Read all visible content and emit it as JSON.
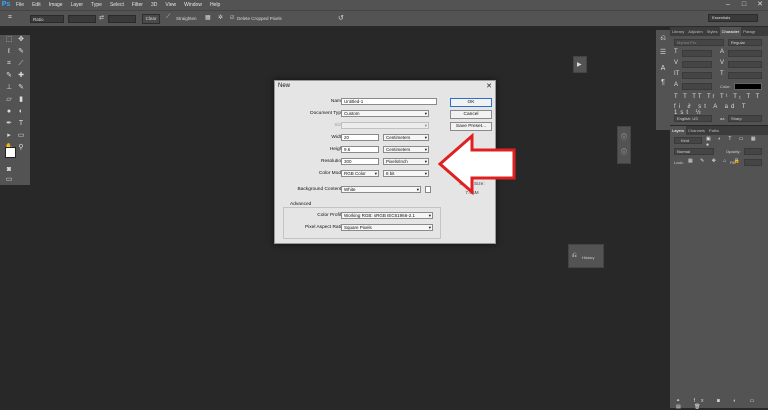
{
  "menubar": {
    "logo": "Ps",
    "items": [
      "File",
      "Edit",
      "Image",
      "Layer",
      "Type",
      "Select",
      "Filter",
      "3D",
      "View",
      "Window",
      "Help"
    ],
    "window_controls": [
      "–",
      "□",
      "✕"
    ]
  },
  "options": {
    "ratio_label": "Ratio",
    "clear_label": "Clear",
    "straighten_label": "Straighten",
    "delete_cropped_label": "Delete Cropped Pixels",
    "workspace": "Essentials"
  },
  "panels": {
    "character_tabs": [
      "Library",
      "Adjustm",
      "Styles",
      "Character",
      "Paragr"
    ],
    "character_active": "Character",
    "font_family": "Myriad Pro",
    "font_style": "Regular",
    "color_label": "Color:",
    "layers_tabs": [
      "Layers",
      "Channels",
      "Paths"
    ],
    "layers_active": "Layers",
    "kind_label": "Kind",
    "blend_mode": "Normal",
    "opacity_label": "Opacity:",
    "lock_label": "Lock:",
    "fill_label": "Fill:",
    "english_label": "English: US",
    "aa_label": "Sharp"
  },
  "floating": {
    "history_label": "History"
  },
  "dialog": {
    "title": "New",
    "name_label": "Name:",
    "name_value": "Untitled-1",
    "doc_type_label": "Document Type:",
    "doc_type_value": "Custom",
    "size_label": "Size:",
    "width_label": "Width:",
    "width_value": "20",
    "width_unit": "Centimeters",
    "height_label": "Height:",
    "height_value": "9.6",
    "height_unit": "Centimeters",
    "resolution_label": "Resolution:",
    "resolution_value": "300",
    "resolution_unit": "Pixels/Inch",
    "color_mode_label": "Color Mode:",
    "color_mode_value": "RGB Color",
    "bit_depth_value": "8 bit",
    "bg_contents_label": "Background Contents:",
    "bg_contents_value": "White",
    "advanced_label": "Advanced",
    "color_profile_label": "Color Profile:",
    "color_profile_value": "Working RGB: sRGB IEC61966-2.1",
    "pixel_aspect_label": "Pixel Aspect Ratio:",
    "pixel_aspect_value": "Square Pixels",
    "ok_label": "OK",
    "cancel_label": "Cancel",
    "save_preset_label": "Save Preset...",
    "image_size_label": "Image Size:",
    "image_size_value": "7.66M"
  },
  "colors": {
    "arrow_fill": "#ffffff",
    "arrow_stroke": "#e02020",
    "foreground_swatch": "#ffffff",
    "background_swatch": "#e01e1e"
  }
}
